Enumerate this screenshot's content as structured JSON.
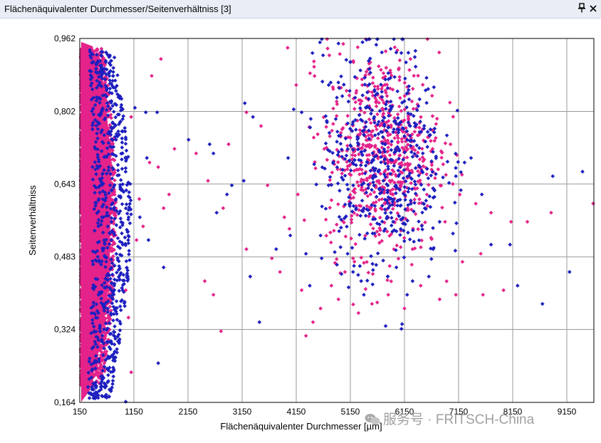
{
  "window": {
    "title": "Flächenäquivalenter Durchmesser/Seitenverhältniss [3]",
    "pin_icon": "pin-icon",
    "close_icon": "close-icon"
  },
  "watermark": {
    "text": "服务号 · FRITSCH-China",
    "icon": "wechat-icon"
  },
  "colors": {
    "series_a": "#e4238a",
    "series_b": "#1d1fbf",
    "grid": "#999999",
    "background": "#ffffff"
  },
  "chart_data": {
    "type": "scatter",
    "title": "",
    "xlabel": "Flächenäquivalenter Durchmesser [µm]",
    "ylabel": "Seitenverhältniss",
    "xlim": [
      150,
      9650
    ],
    "ylim": [
      0.164,
      0.962
    ],
    "x_ticks": [
      150,
      1150,
      2150,
      3150,
      4150,
      5150,
      6150,
      7150,
      8150,
      9150
    ],
    "y_ticks": [
      0.164,
      0.324,
      0.483,
      0.643,
      0.802,
      0.962
    ],
    "x_tick_labels": [
      "150",
      "1150",
      "2150",
      "3150",
      "4150",
      "5150",
      "6150",
      "7150",
      "8150",
      "9150"
    ],
    "y_tick_labels": [
      "0,164",
      "0,324",
      "0,483",
      "0,643",
      "0,802",
      "0,962"
    ],
    "grid": true,
    "legend": "none",
    "marker": "diamond",
    "series": [
      {
        "color": "#e4238a",
        "points": [
          [
            1650,
            0.917
          ],
          [
            1480,
            0.88
          ],
          [
            1100,
            0.79
          ],
          [
            1250,
            0.61
          ],
          [
            1440,
            0.69
          ],
          [
            1600,
            0.68
          ],
          [
            1800,
            0.62
          ],
          [
            1000,
            0.41
          ],
          [
            1050,
            0.35
          ],
          [
            1100,
            0.23
          ],
          [
            1200,
            0.52
          ],
          [
            1320,
            0.55
          ],
          [
            1700,
            0.59
          ],
          [
            1900,
            0.72
          ],
          [
            2300,
            0.71
          ],
          [
            2900,
            0.73
          ],
          [
            2520,
            0.65
          ],
          [
            2460,
            0.43
          ],
          [
            2620,
            0.4
          ],
          [
            2800,
            0.59
          ],
          [
            2760,
            0.32
          ],
          [
            3230,
            0.8
          ],
          [
            3500,
            0.77
          ],
          [
            3620,
            0.64
          ],
          [
            3700,
            0.48
          ],
          [
            3930,
            0.57
          ],
          [
            3850,
            0.45
          ],
          [
            3230,
            0.5
          ],
          [
            4150,
            0.86
          ],
          [
            4480,
            0.9
          ],
          [
            4730,
            0.94
          ],
          [
            4180,
            0.62
          ],
          [
            4250,
            0.41
          ],
          [
            4330,
            0.31
          ],
          [
            4460,
            0.34
          ],
          [
            4600,
            0.37
          ],
          [
            4800,
            0.42
          ],
          [
            4930,
            0.39
          ],
          [
            5050,
            0.45
          ],
          [
            5300,
            0.36
          ],
          [
            5550,
            0.38
          ],
          [
            5850,
            0.4
          ],
          [
            6150,
            0.37
          ],
          [
            6450,
            0.42
          ],
          [
            6800,
            0.39
          ],
          [
            7100,
            0.4
          ],
          [
            7560,
            0.49
          ],
          [
            7600,
            0.4
          ],
          [
            7750,
            0.58
          ],
          [
            7980,
            0.41
          ],
          [
            8120,
            0.56
          ],
          [
            8420,
            0.56
          ],
          [
            8860,
            0.58
          ],
          [
            9660,
            0.6
          ],
          [
            7000,
            0.73
          ],
          [
            6900,
            0.56
          ],
          [
            5200,
            0.48
          ],
          [
            5400,
            0.47
          ],
          [
            6300,
            0.5
          ]
        ]
      },
      {
        "color": "#1d1fbf",
        "points": [
          [
            1370,
            0.8
          ],
          [
            1170,
            0.81
          ],
          [
            1580,
            0.8
          ],
          [
            1390,
            0.7
          ],
          [
            1420,
            0.52
          ],
          [
            1260,
            0.57
          ],
          [
            1700,
            0.46
          ],
          [
            2160,
            0.74
          ],
          [
            2550,
            0.73
          ],
          [
            2620,
            0.71
          ],
          [
            2680,
            0.58
          ],
          [
            2870,
            0.62
          ],
          [
            2960,
            0.64
          ],
          [
            3200,
            0.82
          ],
          [
            3350,
            0.79
          ],
          [
            3180,
            0.65
          ],
          [
            3300,
            0.44
          ],
          [
            3470,
            0.34
          ],
          [
            3780,
            0.5
          ],
          [
            4000,
            0.7
          ],
          [
            4040,
            0.53
          ],
          [
            4250,
            0.8
          ],
          [
            4330,
            0.49
          ],
          [
            4400,
            0.42
          ],
          [
            4600,
            0.53
          ],
          [
            4620,
            0.48
          ],
          [
            4450,
            0.93
          ],
          [
            4750,
            0.86
          ],
          [
            5150,
            0.91
          ],
          [
            5100,
            0.49
          ],
          [
            5200,
            0.45
          ],
          [
            5400,
            0.4
          ],
          [
            5650,
            0.97
          ],
          [
            5350,
            0.43
          ],
          [
            5840,
            0.44
          ],
          [
            6000,
            0.46
          ],
          [
            6200,
            0.4
          ],
          [
            6300,
            0.43
          ],
          [
            6600,
            0.44
          ],
          [
            6800,
            0.56
          ],
          [
            6680,
            0.5
          ],
          [
            7100,
            0.66
          ],
          [
            7380,
            0.7
          ],
          [
            7580,
            0.62
          ],
          [
            7260,
            0.69
          ],
          [
            7750,
            0.51
          ],
          [
            8100,
            0.51
          ],
          [
            8240,
            0.42
          ],
          [
            8700,
            0.38
          ],
          [
            8890,
            0.66
          ],
          [
            9200,
            0.45
          ],
          [
            9440,
            0.67
          ],
          [
            6500,
            0.6
          ],
          [
            5900,
            0.58
          ],
          [
            1000,
            0.165
          ],
          [
            1600,
            0.25
          ]
        ]
      }
    ],
    "clusters": [
      {
        "series": 0,
        "n": 2400,
        "x": [
          150,
          800
        ],
        "y": [
          0.2,
          0.94
        ],
        "shape": "dense-band"
      },
      {
        "series": 1,
        "n": 700,
        "x": [
          150,
          1100
        ],
        "y": [
          0.17,
          0.94
        ],
        "shape": "band-edge"
      },
      {
        "series": 0,
        "n": 650,
        "cx": 5750,
        "cy": 0.71,
        "sx": 520,
        "sy": 0.11
      },
      {
        "series": 1,
        "n": 520,
        "cx": 5750,
        "cy": 0.7,
        "sx": 560,
        "sy": 0.12
      }
    ]
  }
}
